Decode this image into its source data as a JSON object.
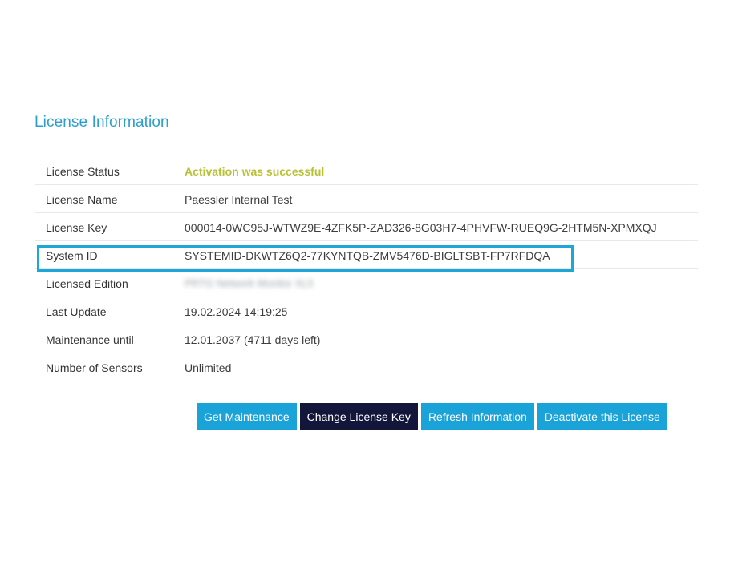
{
  "section": {
    "title": "License Information"
  },
  "rows": [
    {
      "label": "License Status",
      "value": "Activation was successful"
    },
    {
      "label": "License Name",
      "value": "Paessler Internal Test"
    },
    {
      "label": "License Key",
      "value": "000014-0WC95J-WTWZ9E-4ZFK5P-ZAD326-8G03H7-4PHVFW-RUEQ9G-2HTM5N-XPMXQJ"
    },
    {
      "label": "System ID",
      "value": "SYSTEMID-DKWTZ6Q2-77KYNTQB-ZMV5476D-BIGLTSBT-FP7RFDQA"
    },
    {
      "label": "Licensed Edition",
      "value": "PRTG Network Monitor XL5"
    },
    {
      "label": "Last Update",
      "value": "19.02.2024 14:19:25"
    },
    {
      "label": "Maintenance until",
      "value": "12.01.2037 (4711 days left)"
    },
    {
      "label": "Number of Sensors",
      "value": "Unlimited"
    }
  ],
  "buttons": {
    "get_maintenance": "Get Maintenance",
    "change_license_key": "Change License Key",
    "refresh_information": "Refresh Information",
    "deactivate_license": "Deactivate this License"
  },
  "colors": {
    "accent": "#1aa3d9",
    "title": "#2a9fcf",
    "success": "#b8c234",
    "dark_button": "#12163a",
    "highlight_border": "#1da7d8"
  }
}
